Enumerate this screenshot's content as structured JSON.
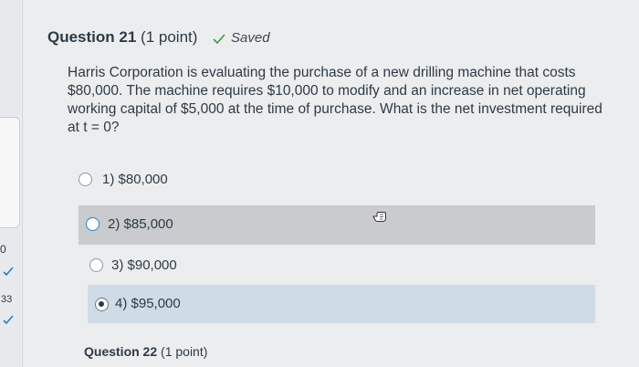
{
  "question": {
    "number_label": "Question 21",
    "points_label": "(1 point)",
    "saved_status": "Saved",
    "text": "Harris Corporation is evaluating the purchase of a new drilling machine that costs $80,000. The machine requires $10,000 to modify and an increase in net operating working capital of $5,000 at the time of purchase. What is the net investment required at t = 0?",
    "answers": [
      {
        "label": "1) $80,000",
        "selected": false
      },
      {
        "label": "2) $85,000",
        "selected": false
      },
      {
        "label": "3) $90,000",
        "selected": false
      },
      {
        "label": "4) $95,000",
        "selected": true
      }
    ]
  },
  "sidebar": {
    "partial_number": "0",
    "question_number": "33"
  },
  "next_question": {
    "number_label": "Question 22",
    "points_label": "(1 point)"
  },
  "colors": {
    "text": "#2d3b45",
    "hover_row": "#c9cbce",
    "selected_row": "#cfdbe6",
    "radio_focus": "#2a7fc5",
    "check_green": "#3a9a4a",
    "check_blue": "#2a7fc5"
  }
}
